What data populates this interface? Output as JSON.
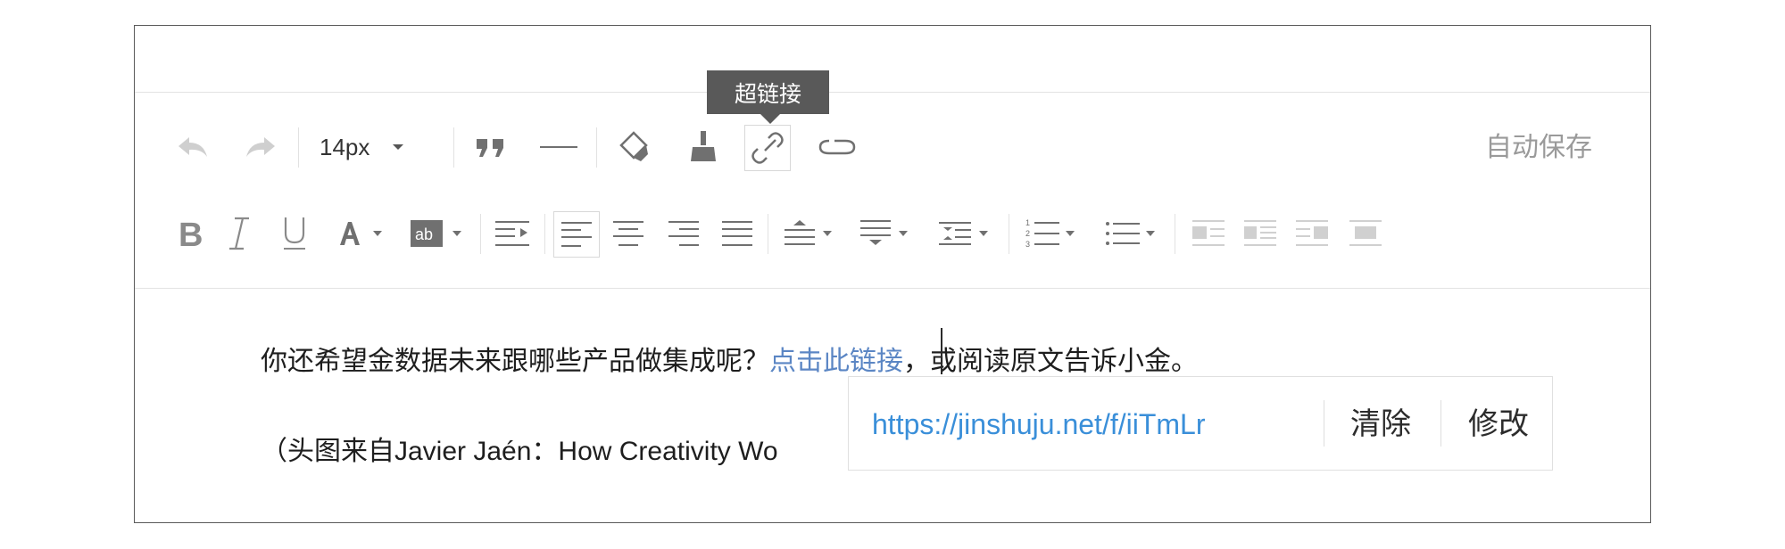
{
  "toolbar": {
    "font_size": "14px",
    "autosave_label": "自动保存",
    "tooltip": "超链接",
    "row1_icons": [
      "undo-icon",
      "redo-icon",
      "quote-icon",
      "horizontal-rule-icon",
      "format-painter-icon",
      "clear-format-icon",
      "link-icon",
      "unlink-icon"
    ],
    "row2_icons": [
      "bold-icon",
      "italic-icon",
      "underline-icon",
      "font-color-icon",
      "highlight-color-icon",
      "indent-icon",
      "align-left-icon",
      "align-center-icon",
      "align-right-icon",
      "align-justify-icon",
      "paragraph-spacing-before-icon",
      "paragraph-spacing-after-icon",
      "line-height-icon",
      "ordered-list-icon",
      "unordered-list-icon",
      "image-left-icon",
      "image-inline-icon",
      "image-right-icon",
      "image-center-icon"
    ],
    "active_alignment": "align-left",
    "link_button_state": "hover"
  },
  "content": {
    "line1_text": "你还希望金数据未来跟哪些产品做集成呢？",
    "line1_link_part1": "点击此",
    "line1_link_part2": "链接",
    "line1_after": "，或阅读原文告诉小金。",
    "line2_text": "（头图来自Javier Jaén：How Creativity Wo"
  },
  "link_popup": {
    "url": "https://jinshuju.net/f/iiTmLr",
    "clear_label": "清除",
    "edit_label": "修改"
  },
  "colors": {
    "link": "#5b86c4",
    "popup_url": "#3a8fd9",
    "tooltip_bg": "#595959",
    "icon": "#707070"
  }
}
